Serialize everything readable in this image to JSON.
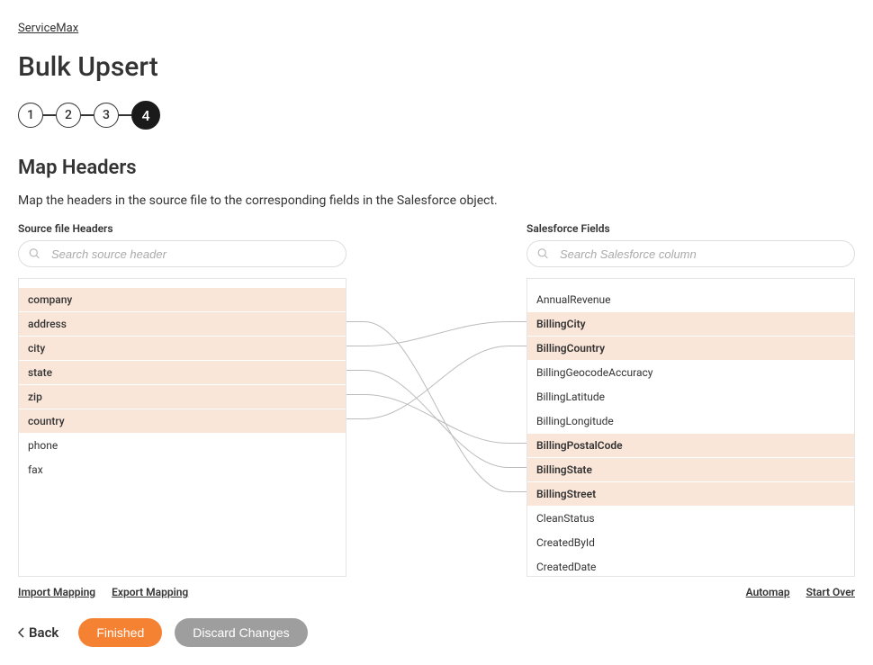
{
  "breadcrumb": "ServiceMax",
  "page_title": "Bulk Upsert",
  "stepper": {
    "steps": [
      "1",
      "2",
      "3",
      "4"
    ],
    "active_index": 3
  },
  "section": {
    "title": "Map Headers",
    "description": "Map the headers in the source file to the corresponding fields in the Salesforce object."
  },
  "source": {
    "label": "Source file Headers",
    "search_placeholder": "Search source header",
    "items": [
      {
        "label": "company",
        "mapped": true
      },
      {
        "label": "address",
        "mapped": true
      },
      {
        "label": "city",
        "mapped": true
      },
      {
        "label": "state",
        "mapped": true
      },
      {
        "label": "zip",
        "mapped": true
      },
      {
        "label": "country",
        "mapped": true
      },
      {
        "label": "phone",
        "mapped": false
      },
      {
        "label": "fax",
        "mapped": false
      }
    ],
    "links": {
      "import": "Import Mapping",
      "export": "Export Mapping"
    }
  },
  "target": {
    "label": "Salesforce Fields",
    "search_placeholder": "Search Salesforce column",
    "items": [
      {
        "label": "AnnualRevenue",
        "mapped": false
      },
      {
        "label": "BillingCity",
        "mapped": true
      },
      {
        "label": "BillingCountry",
        "mapped": true
      },
      {
        "label": "BillingGeocodeAccuracy",
        "mapped": false
      },
      {
        "label": "BillingLatitude",
        "mapped": false
      },
      {
        "label": "BillingLongitude",
        "mapped": false
      },
      {
        "label": "BillingPostalCode",
        "mapped": true
      },
      {
        "label": "BillingState",
        "mapped": true
      },
      {
        "label": "BillingStreet",
        "mapped": true
      },
      {
        "label": "CleanStatus",
        "mapped": false
      },
      {
        "label": "CreatedById",
        "mapped": false
      },
      {
        "label": "CreatedDate",
        "mapped": false
      }
    ],
    "links": {
      "automap": "Automap",
      "startover": "Start Over"
    }
  },
  "connections": [
    {
      "from": 1,
      "to": 8
    },
    {
      "from": 2,
      "to": 1
    },
    {
      "from": 3,
      "to": 7
    },
    {
      "from": 4,
      "to": 6
    },
    {
      "from": 5,
      "to": 2
    }
  ],
  "footer": {
    "back": "Back",
    "finished": "Finished",
    "discard": "Discard Changes"
  }
}
